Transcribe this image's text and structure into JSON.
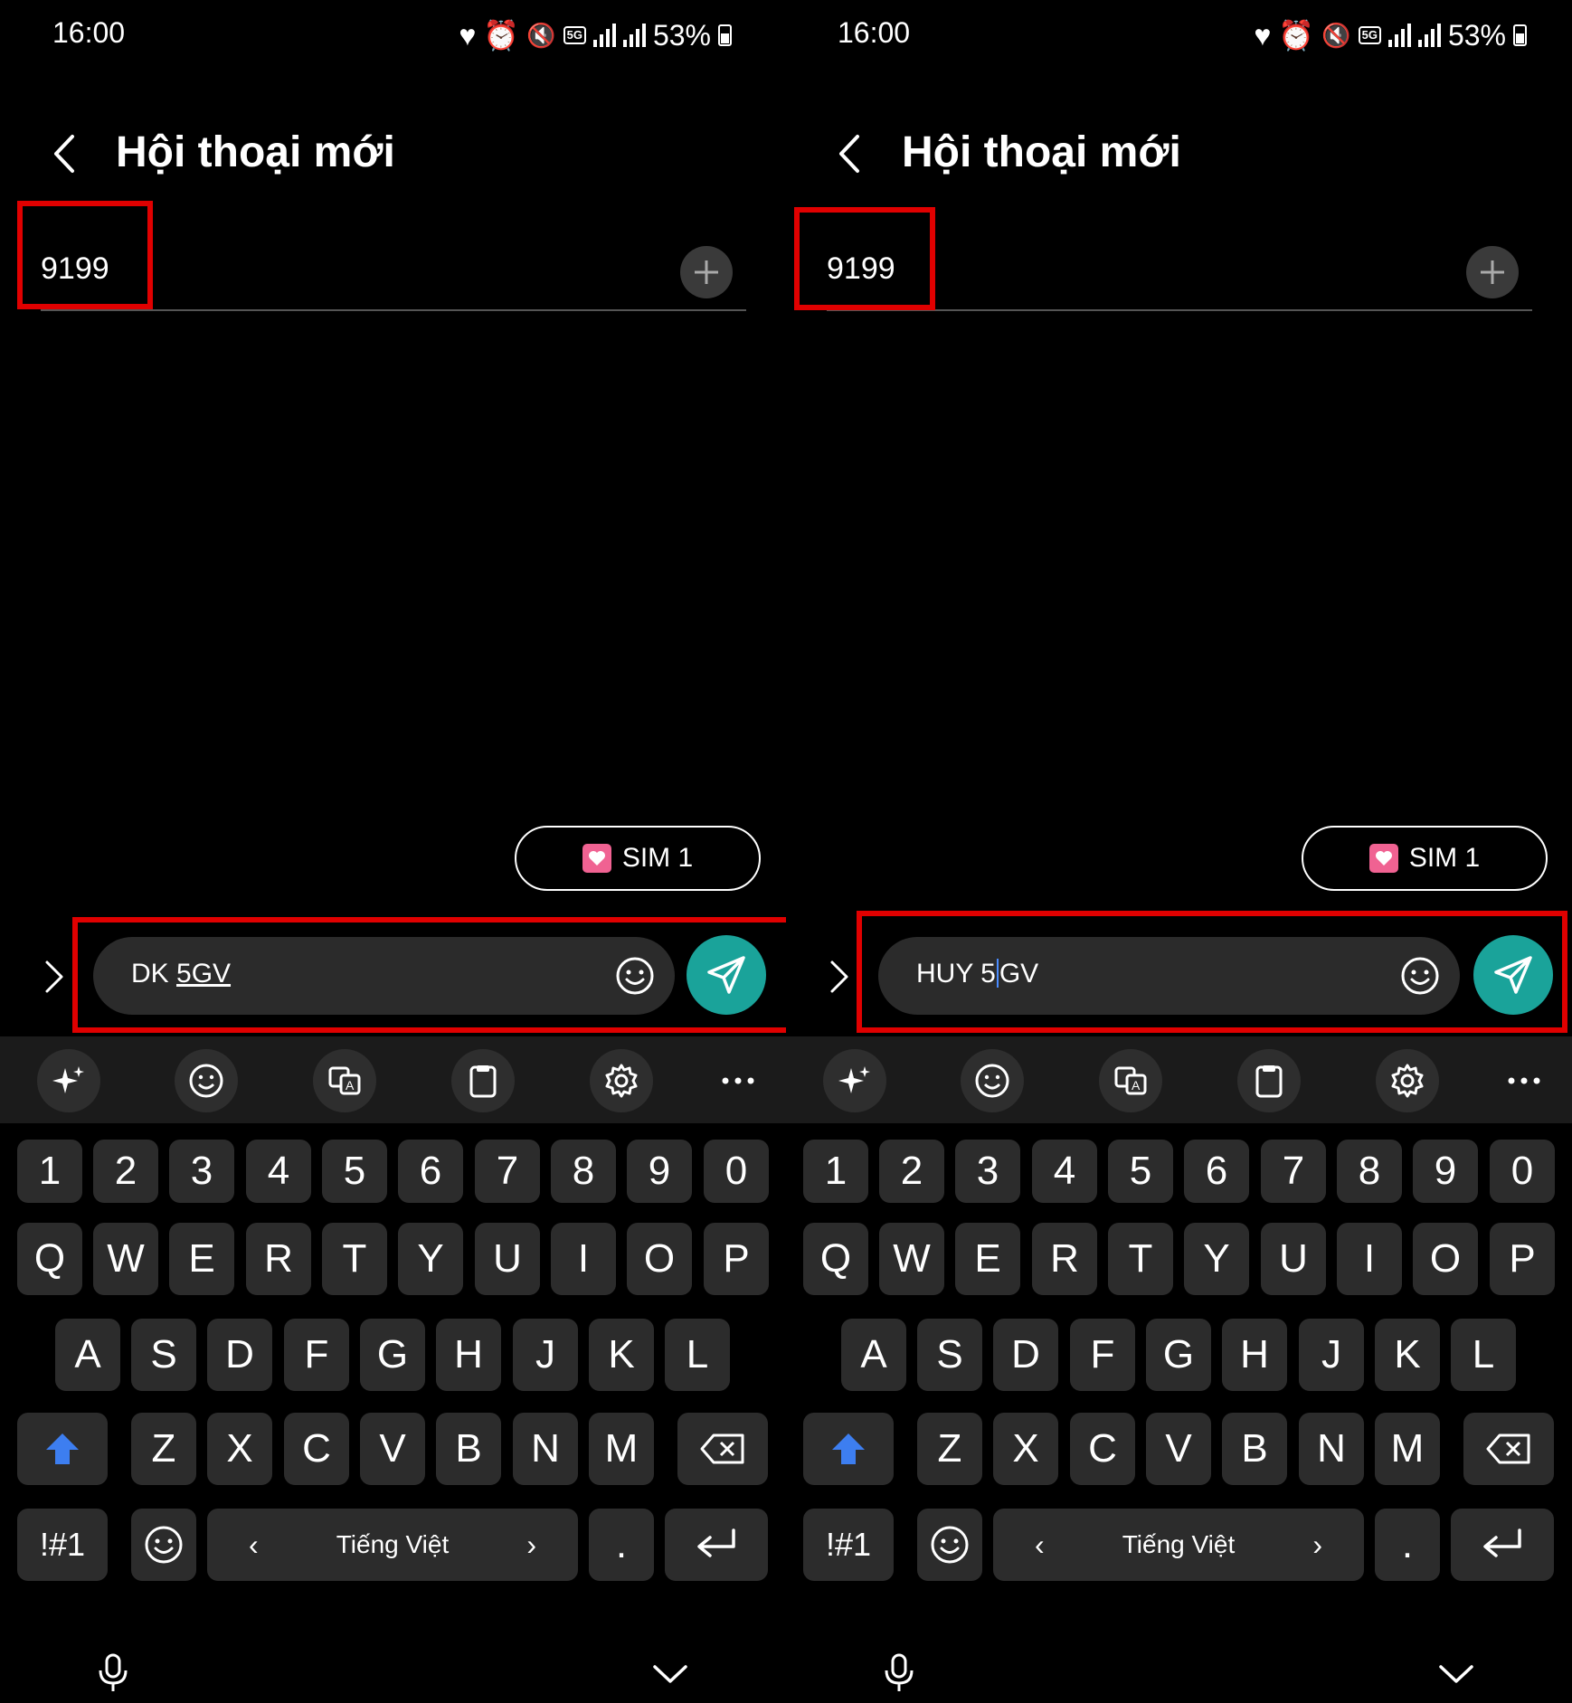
{
  "status": {
    "time": "16:00",
    "battery": "53%",
    "network": "5G"
  },
  "header": {
    "title": "Hội thoại mới"
  },
  "recipient": {
    "value": "9199"
  },
  "sim": {
    "label": "SIM 1"
  },
  "panels": [
    {
      "message_prefix": "DK ",
      "message_suffix": "5GV",
      "caret_after": ""
    },
    {
      "message_prefix": "HUY 5",
      "message_suffix": "GV",
      "caret_after": ""
    }
  ],
  "keyboard": {
    "numbers": [
      "1",
      "2",
      "3",
      "4",
      "5",
      "6",
      "7",
      "8",
      "9",
      "0"
    ],
    "row1": [
      "Q",
      "W",
      "E",
      "R",
      "T",
      "Y",
      "U",
      "I",
      "O",
      "P"
    ],
    "row2": [
      "A",
      "S",
      "D",
      "F",
      "G",
      "H",
      "J",
      "K",
      "L"
    ],
    "row3": [
      "Z",
      "X",
      "C",
      "V",
      "B",
      "N",
      "M"
    ],
    "symbols_label": "!#1",
    "language": "Tiếng Việt",
    "period": "."
  },
  "colors": {
    "accent_send": "#1aa39a",
    "highlight_box": "#e00000",
    "shift": "#3d7ef0",
    "sim_icon": "#f06292"
  }
}
